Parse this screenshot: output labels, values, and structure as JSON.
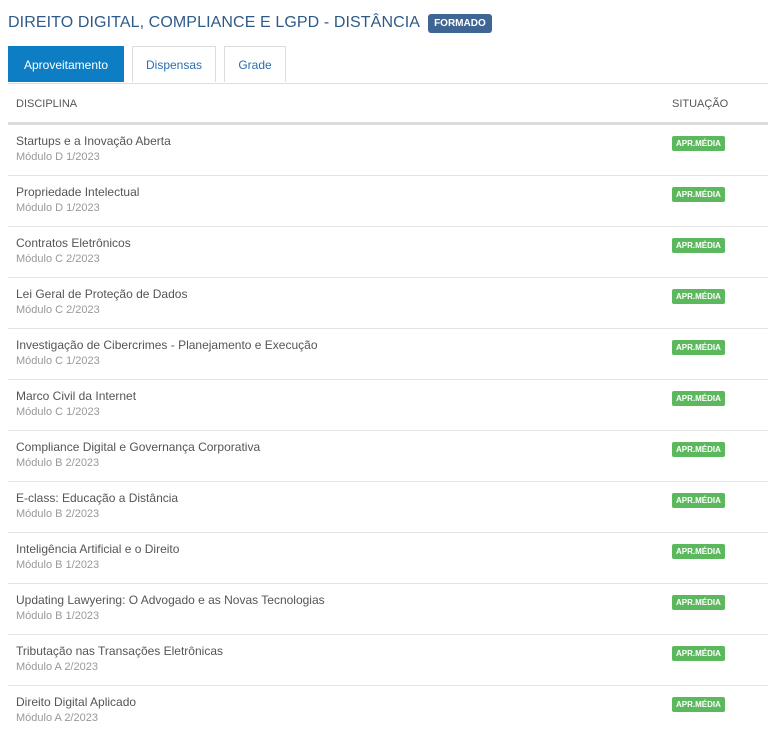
{
  "header": {
    "course_title": "DIREITO DIGITAL, COMPLIANCE E LGPD - DISTÂNCIA",
    "status_badge": "FORMADO"
  },
  "tabs": [
    {
      "label": "Aproveitamento",
      "active": true
    },
    {
      "label": "Dispensas",
      "active": false
    },
    {
      "label": "Grade",
      "active": false
    }
  ],
  "table": {
    "columns": [
      "DISCIPLINA",
      "SITUAÇÃO"
    ],
    "rows": [
      {
        "name": "Startups e a Inovação Aberta",
        "module": "Módulo D 1/2023",
        "status": "APR.MÉDIA"
      },
      {
        "name": "Propriedade Intelectual",
        "module": "Módulo D 1/2023",
        "status": "APR.MÉDIA"
      },
      {
        "name": "Contratos Eletrônicos",
        "module": "Módulo C 2/2023",
        "status": "APR.MÉDIA"
      },
      {
        "name": "Lei Geral de Proteção de Dados",
        "module": "Módulo C 2/2023",
        "status": "APR.MÉDIA"
      },
      {
        "name": "Investigação de Cibercrimes - Planejamento e Execução",
        "module": "Módulo C 1/2023",
        "status": "APR.MÉDIA"
      },
      {
        "name": "Marco Civil da Internet",
        "module": "Módulo C 1/2023",
        "status": "APR.MÉDIA"
      },
      {
        "name": "Compliance Digital e Governança Corporativa",
        "module": "Módulo B 2/2023",
        "status": "APR.MÉDIA"
      },
      {
        "name": "E-class: Educação a Distância",
        "module": "Módulo B 2/2023",
        "status": "APR.MÉDIA"
      },
      {
        "name": "Inteligência Artificial e o Direito",
        "module": "Módulo B 1/2023",
        "status": "APR.MÉDIA"
      },
      {
        "name": "Updating Lawyering: O Advogado e as Novas Tecnologias",
        "module": "Módulo B 1/2023",
        "status": "APR.MÉDIA"
      },
      {
        "name": "Tributação nas Transações Eletrônicas",
        "module": "Módulo A 2/2023",
        "status": "APR.MÉDIA"
      },
      {
        "name": "Direito Digital Aplicado",
        "module": "Módulo A 2/2023",
        "status": "APR.MÉDIA"
      }
    ]
  },
  "colors": {
    "title": "#2e5a8a",
    "status_badge_bg": "#3f6594",
    "active_tab_bg": "#0d7ec4",
    "tab_text": "#2a6fb0",
    "approved_badge_bg": "#5cb85c"
  }
}
